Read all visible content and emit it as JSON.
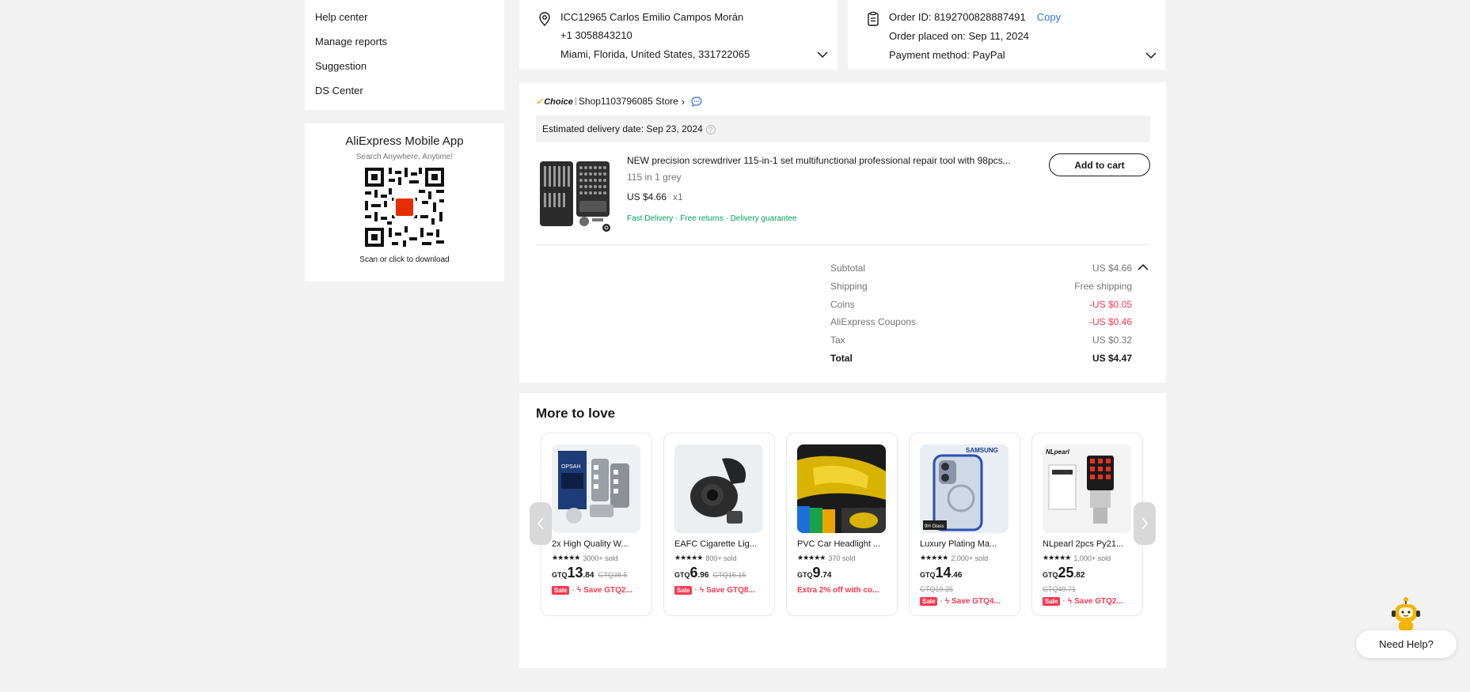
{
  "sidebar": {
    "links": [
      "Help center",
      "Manage reports",
      "Suggestion",
      "DS Center"
    ]
  },
  "app_promo": {
    "title": "AliExpress Mobile App",
    "subtitle": "Search Anywhere, Anytime!",
    "download_label": "Scan or click to download"
  },
  "address": {
    "name": "ICC12965 Carlos Emilio Campos Morán",
    "phone": "+1 3058843210",
    "location": "Miami, Florida, United States, 331722065",
    "icon": "location-pin-icon"
  },
  "order": {
    "order_id_label": "Order ID: 8192700828887491",
    "copy_label": "Copy",
    "placed_on": "Order placed on: Sep 11, 2024",
    "payment": "Payment method: PayPal",
    "icon": "clipboard-icon"
  },
  "store": {
    "badge": "Choice",
    "name": "Shop1103796085 Store",
    "delivery_estimate": "Estimated delivery date: Sep 23, 2024"
  },
  "item": {
    "title": "NEW precision screwdriver 115-in-1 set multifunctional professional repair tool with 98pcs...",
    "variant": "115 in 1 grey",
    "price": "US $4.66",
    "quantity": "x1",
    "tags": "Fast Delivery · Free returns · Delivery guarantee",
    "add_to_cart_label": "Add to cart"
  },
  "summary": {
    "rows": [
      {
        "label": "Subtotal",
        "value": "US $4.66"
      },
      {
        "label": "Shipping",
        "value": "Free shipping"
      },
      {
        "label": "Coins",
        "value": "-US $0.05"
      },
      {
        "label": "AliExpress Coupons",
        "value": "-US $0.46"
      },
      {
        "label": "Tax",
        "value": "US $0.32"
      },
      {
        "label": "Total",
        "value": "US $4.47"
      }
    ],
    "discount_color": "#fd384f"
  },
  "more_to_love": {
    "title": "More to love",
    "products": [
      {
        "title": "2x High Quality W...",
        "sold": "3000+ sold",
        "currency": "GTQ",
        "price_int": "13",
        "price_dec": ".84",
        "old_price": "GTQ38.5",
        "sale": "Sale",
        "promo": "Save GTQ2..."
      },
      {
        "title": "EAFC Cigarette Lig...",
        "sold": "800+ sold",
        "currency": "GTQ",
        "price_int": "6",
        "price_dec": ".96",
        "old_price": "GTQ15.15",
        "sale": "Sale",
        "promo": "Save GTQ8..."
      },
      {
        "title": "PVC Car Headlight ...",
        "sold": "370 sold",
        "currency": "GTQ",
        "price_int": "9",
        "price_dec": ".74",
        "old_price": "",
        "sale": "",
        "promo": "Extra 2% off with co..."
      },
      {
        "title": "Luxury Plating Ma...",
        "sold": "2,000+ sold",
        "currency": "GTQ",
        "price_int": "14",
        "price_dec": ".46",
        "old_price": "GTQ19.25",
        "sale": "Sale",
        "promo": "Save GTQ4..."
      },
      {
        "title": "NLpearl 2pcs Py21...",
        "sold": "1,000+ sold",
        "currency": "GTQ",
        "price_int": "25",
        "price_dec": ".82",
        "old_price": "GTQ49.71",
        "sale": "Sale",
        "promo": "Save GTQ2..."
      }
    ],
    "image_text": {
      "brand_1": "OPSAH",
      "brand_4": "SAMSUNG",
      "glass_4": "9H Glass",
      "brand_5": "NLpearl"
    }
  },
  "help": {
    "label": "Need Help?"
  },
  "colors": {
    "accent_blue": "#2e72e6",
    "green_tags": "#00a35c",
    "sale_red": "#fd384f",
    "choice_orange": "#fda100"
  }
}
